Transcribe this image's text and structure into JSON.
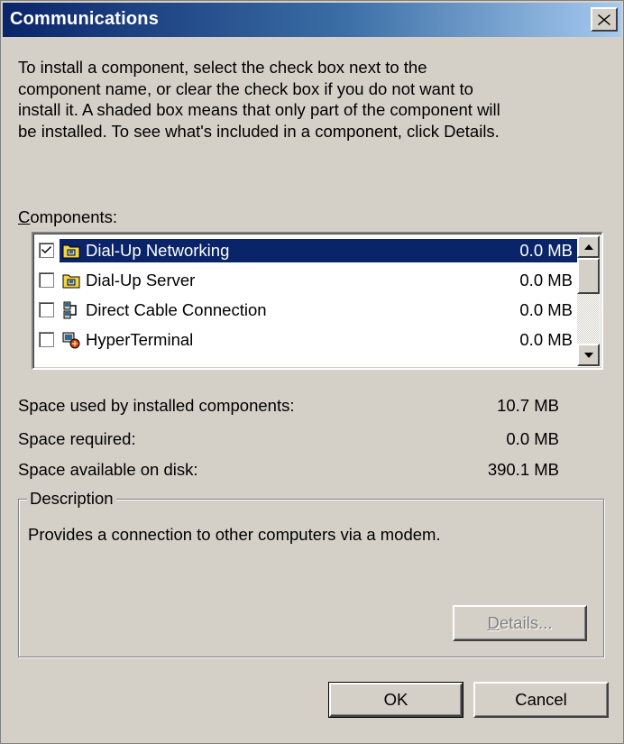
{
  "window": {
    "title": "Communications",
    "close_glyph": "✕"
  },
  "intro_lines": [
    "To install a component, select the check box next to the",
    "component name, or clear the check box if you do not want to",
    "install it. A shaded box means that only part of the component will",
    "be installed. To see what's included in a component, click Details."
  ],
  "components": {
    "label_mnemonic": "C",
    "label_rest": "omponents:",
    "items": [
      {
        "name": "Dial-Up Networking",
        "size": "0.0 MB",
        "checked": true,
        "selected": true,
        "icon": "dialup-networking-icon"
      },
      {
        "name": "Dial-Up Server",
        "size": "0.0 MB",
        "checked": false,
        "selected": false,
        "icon": "dialup-server-icon"
      },
      {
        "name": "Direct Cable Connection",
        "size": "0.0 MB",
        "checked": false,
        "selected": false,
        "icon": "direct-cable-icon"
      },
      {
        "name": "HyperTerminal",
        "size": "0.0 MB",
        "checked": false,
        "selected": false,
        "icon": "hyperterminal-icon"
      }
    ]
  },
  "space": {
    "installed_label": "Space used by installed components:",
    "installed_value": "10.7 MB",
    "required_label": "Space required:",
    "required_value": "0.0 MB",
    "available_label": "Space available on disk:",
    "available_value": "390.1 MB"
  },
  "description": {
    "legend": "Description",
    "text": "Provides a connection to other computers via a modem."
  },
  "buttons": {
    "details_mnemonic": "D",
    "details_rest": "etails...",
    "ok": "OK",
    "cancel": "Cancel"
  },
  "colors": {
    "face": "#d4d0c8",
    "title_start": "#0a246a",
    "title_end": "#a6caf0",
    "selection": "#0a246a"
  }
}
